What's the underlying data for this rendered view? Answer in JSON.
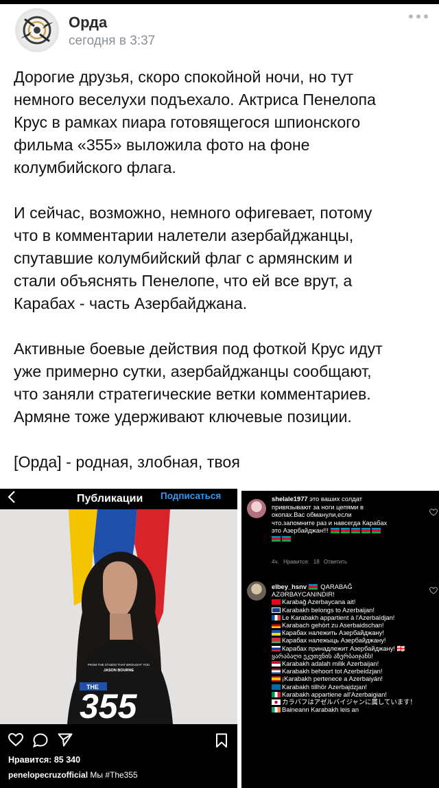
{
  "post": {
    "author": "Орда",
    "time": "сегодня в 3:37",
    "paragraph1": [
      "Дорогие друзья, скоро спокойной ночи, но тут",
      "немного веселухи подъехало. Актриса Пенелопа",
      "Крус в рамках пиара готовящегося шпионского",
      "фильма «355» выложила фото на фоне",
      "колумбийского флага."
    ],
    "paragraph2": [
      "И сейчас, возможно, немного офигевает, потому",
      "что в комментарии налетели азербайджанцы,",
      "спутавшие колумбийский флаг с армянским и",
      "стали объяснять Пенелопе, что ей все врут, а",
      "Карабах - часть Азербайджана."
    ],
    "paragraph3": [
      "Активные боевые действия под фоткой Крус идут",
      "уже примерно сутки, азербайджанцы сообщают,",
      "что заняли стратегические ветки комментариев.",
      "Армяне тоже удерживают ключевые позиции."
    ],
    "signature": "[Орда] - родная, злобная, твоя"
  },
  "instagram": {
    "title": "Публикации",
    "subscribe": "Подписаться",
    "poster_tagline": "FROM THE STUDIO THAT BROUGHT YOU",
    "poster_tagline2": "JASON BOURNE",
    "poster_the": "THE",
    "poster_number": "355",
    "likes": "Нравится: 85 340",
    "caption_user": "penelopecruzofficial",
    "caption_text": " Мы #The355"
  },
  "comments": {
    "c1_user": "shelale1977",
    "c1_lines": [
      " это ваших солдат",
      "привязывают за ноги цепями в",
      "окопах.Вас обманули,если",
      "что.запомните раз и навсегда Карабах",
      "это Азербайджан!!!"
    ],
    "c1_meta": "4ч. Нравится: 18 Ответить",
    "c2_user": "elbey_hsnv",
    "c2_first": " QARABAĞ",
    "c2_second": "AZƏRBAYCANINDIR!",
    "c2_lines": [
      {
        "flag": "tr",
        "text": "Karabağ Azerbaycana ait!"
      },
      {
        "flag": "gb",
        "text": "Karabakh belongs to Azerbaijan!"
      },
      {
        "flag": "fr",
        "text": "Le Karabakh appartient à l'Azerbaïdjan!"
      },
      {
        "flag": "de",
        "text": "Karabach gehört zu Aserbaidschan!"
      },
      {
        "flag": "ua",
        "text": "Карабах належить Азербайджану!"
      },
      {
        "flag": "by",
        "text": "Карабах належыць Азербайджану!"
      },
      {
        "flag": "ru",
        "text": "Карабах принадлежит Азербайджану! 🇬🇪ყარაბაღი ეკუთვნის აზერბაიჯანს!"
      },
      {
        "flag": "id",
        "text": "Karabakh adalah milik Azerbaijan!"
      },
      {
        "flag": "nl",
        "text": "Karabakh behoort tot Azerbeidzjan!"
      },
      {
        "flag": "es",
        "text": "¡Karabakh pertenece a Azerbaiyán!"
      },
      {
        "flag": "se",
        "text": "Karabakh tillhör Azerbajdzjan!"
      },
      {
        "flag": "it",
        "text": "Karabakh appartiene all'Azerbaigian!"
      },
      {
        "flag": "jp",
        "text": "カラバフはアゼルバイジャンに属しています！"
      },
      {
        "flag": "ie",
        "text": "Baineann Karabakh leis an"
      }
    ]
  },
  "colors": {
    "author": "#2a2a2a",
    "time": "#8a8f96",
    "ig_link": "#3897f0",
    "flag_yellow": "#f4c400",
    "flag_blue": "#1f4fa8",
    "flag_red": "#d8232a"
  },
  "icons": [
    "more-icon",
    "back-icon",
    "heart-icon",
    "comment-icon",
    "share-icon",
    "bookmark-icon"
  ]
}
